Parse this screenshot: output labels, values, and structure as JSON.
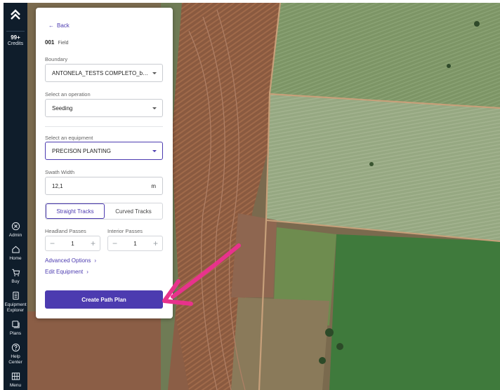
{
  "nav": {
    "credits_count": "99+",
    "credits_label": "Credits",
    "items": [
      {
        "label": "Admin",
        "icon": "admin-icon"
      },
      {
        "label": "Home",
        "icon": "home-icon"
      },
      {
        "label": "Buy",
        "icon": "cart-icon"
      },
      {
        "label": "Equipment Explorer",
        "icon": "equipment-icon"
      },
      {
        "label": "Plans",
        "icon": "plans-icon"
      },
      {
        "label": "Help Center",
        "icon": "help-icon"
      },
      {
        "label": "Menu",
        "icon": "menu-icon"
      }
    ]
  },
  "panel": {
    "back_label": "Back",
    "field_id": "001",
    "field_label": "Field",
    "boundary": {
      "label": "Boundary",
      "value": "ANTONELA_TESTS COMPLETO_bound..."
    },
    "operation": {
      "label": "Select an operation",
      "value": "Seeding"
    },
    "equipment": {
      "label": "Select an equipment",
      "value": "PRECISON PLANTING"
    },
    "swath": {
      "label": "Swath Width",
      "value": "12,1",
      "unit": "m"
    },
    "tracks": {
      "straight": "Straight Tracks",
      "curved": "Curved Tracks",
      "selected": "Straight Tracks"
    },
    "headland": {
      "label": "Headland Passes",
      "value": "1"
    },
    "interior": {
      "label": "Interior Passes",
      "value": "1"
    },
    "advanced_label": "Advanced Options",
    "edit_equipment_label": "Edit Equipment",
    "create_label": "Create Path Plan"
  },
  "colors": {
    "accent": "#4c3bb0",
    "rail": "#0f1d2b",
    "annotation_arrow": "#e8328c"
  }
}
